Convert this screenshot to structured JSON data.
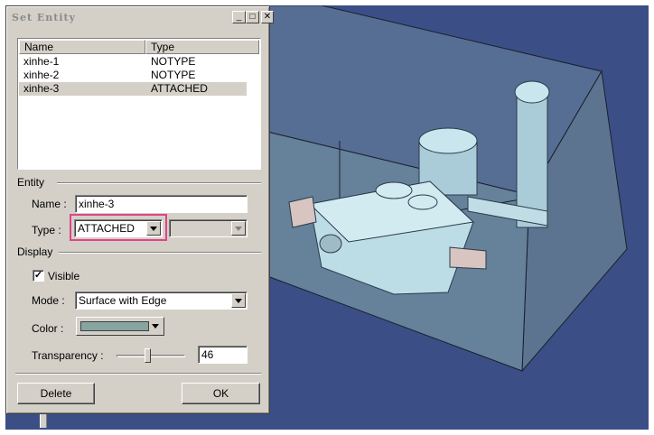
{
  "dialog": {
    "title": "Set Entity",
    "window_buttons": {
      "minimize": "_",
      "maximize": "□",
      "close": "✕"
    }
  },
  "list": {
    "headers": [
      "Name",
      "Type"
    ],
    "rows": [
      {
        "name": "xinhe-1",
        "type": "NOTYPE"
      },
      {
        "name": "xinhe-2",
        "type": "NOTYPE"
      },
      {
        "name": "xinhe-3",
        "type": "ATTACHED",
        "selected": true
      }
    ]
  },
  "entity": {
    "group_label": "Entity",
    "name_label": "Name :",
    "name_value": "xinhe-3",
    "type_label": "Type :",
    "type_value": "ATTACHED",
    "subtype_value": ""
  },
  "display": {
    "group_label": "Display",
    "visible_label": "Visible",
    "visible_checked": true,
    "mode_label": "Mode :",
    "mode_value": "Surface with Edge",
    "color_label": "Color :",
    "color_value": "#86a5a0",
    "transparency_label": "Transparency :",
    "transparency_value": "46"
  },
  "buttons": {
    "delete": "Delete",
    "ok": "OK"
  },
  "colors": {
    "viewport_bg": "#3b4f86",
    "dialog_bg": "#d4d0c8",
    "highlight": "#e0448a",
    "model": "#bcdde6"
  }
}
